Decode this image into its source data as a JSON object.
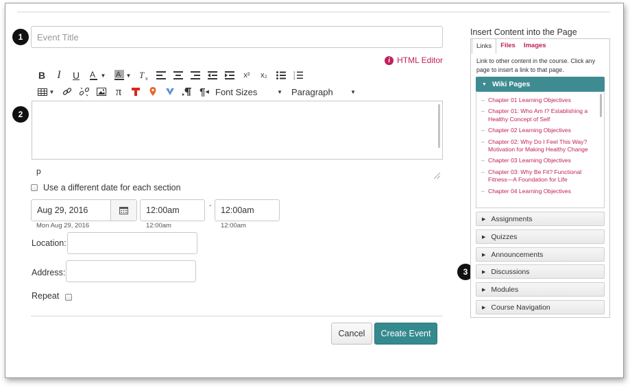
{
  "form": {
    "title_placeholder": "Event Title",
    "html_editor_label": "HTML Editor",
    "font_sizes_label": "Font Sizes",
    "paragraph_label": "Paragraph",
    "path_indicator": "p",
    "different_date_label": "Use a different date for each section",
    "date_value": "Aug 29, 2016",
    "date_hint": "Mon Aug 29, 2016",
    "start_time": "12:00am",
    "start_time_hint": "12:00am",
    "time_separator": "-",
    "end_time": "12:00am",
    "end_time_hint": "12:00am",
    "location_label": "Location:",
    "address_label": "Address:",
    "repeat_label": "Repeat",
    "cancel_label": "Cancel",
    "create_label": "Create Event"
  },
  "toolbar": {
    "bold": "B",
    "italic": "I",
    "underline": "U",
    "superscript": "x²",
    "subscript": "x₂",
    "math": "π",
    "rtl": "¶"
  },
  "callouts": {
    "one": "1",
    "two": "2",
    "three": "3"
  },
  "sidebar": {
    "title": "Insert Content into the Page",
    "tabs": [
      "Links",
      "Files",
      "Images"
    ],
    "description": "Link to other content in the course. Click any page to insert a link to that page.",
    "open_section": "Wiki Pages",
    "wiki_pages": [
      "Chapter 01 Learning Objectives",
      "Chapter 01: Who Am I? Establishing a Healthy Concept of Self",
      "Chapter 02 Learning Objectives",
      "Chapter 02: Why Do I Feel This Way? Motivation for Making Healthy Change",
      "Chapter 03 Learning Objectives",
      "Chapter 03: Why Be Fit? Functional Fitness—A Foundation for Life",
      "Chapter 04 Learning Objectives"
    ],
    "sections": [
      "Assignments",
      "Quizzes",
      "Announcements",
      "Discussions",
      "Modules",
      "Course Navigation"
    ]
  },
  "colors": {
    "accent_teal": "#358a8e",
    "link_magenta": "#c0215c"
  }
}
